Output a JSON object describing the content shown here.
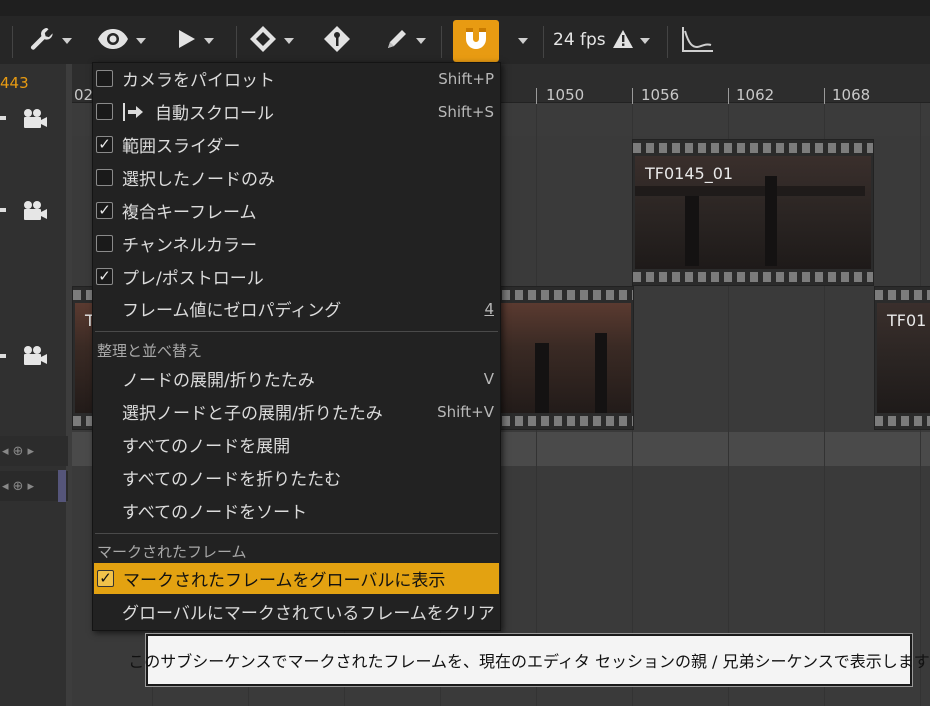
{
  "toolbar": {
    "fps_label": "24 fps",
    "accent_color": "#e89b12"
  },
  "left": {
    "current_frame": "443"
  },
  "ruler": {
    "ticks": [
      "02",
      "1050",
      "1056",
      "1062",
      "1068"
    ]
  },
  "clips": {
    "clip_a": "TF0145_01",
    "clip_b": "T",
    "clip_c": "TF01"
  },
  "menu": {
    "items": [
      {
        "label": "カメラをパイロット",
        "shortcut": "Shift+P",
        "checked": false
      },
      {
        "label": "自動スクロール",
        "shortcut": "Shift+S",
        "checked": false
      },
      {
        "label": "範囲スライダー",
        "shortcut": "",
        "checked": true
      },
      {
        "label": "選択したノードのみ",
        "shortcut": "",
        "checked": false
      },
      {
        "label": "複合キーフレーム",
        "shortcut": "",
        "checked": true
      },
      {
        "label": "チャンネルカラー",
        "shortcut": "",
        "checked": false
      },
      {
        "label": "プレ/ポストロール",
        "shortcut": "",
        "checked": true
      },
      {
        "label": "フレーム値にゼロパディング",
        "shortcut": "4",
        "checked": null
      }
    ],
    "section_sort": "整理と並べ替え",
    "sort_items": [
      {
        "label": "ノードの展開/折りたたみ",
        "shortcut": "V"
      },
      {
        "label": "選択ノードと子の展開/折りたたみ",
        "shortcut": "Shift+V"
      },
      {
        "label": "すべてのノードを展開",
        "shortcut": ""
      },
      {
        "label": "すべてのノードを折りたたむ",
        "shortcut": ""
      },
      {
        "label": "すべてのノードをソート",
        "shortcut": ""
      }
    ],
    "section_marked": "マークされたフレーム",
    "marked_items": [
      {
        "label": "マークされたフレームをグローバルに表示",
        "checked": true
      },
      {
        "label": "グローバルにマークされているフレームをクリア"
      }
    ]
  },
  "tooltip": {
    "text": "このサブシーケンスでマークされたフレームを、現在のエディタ セッションの親 / 兄弟シーケンスで表示します"
  }
}
